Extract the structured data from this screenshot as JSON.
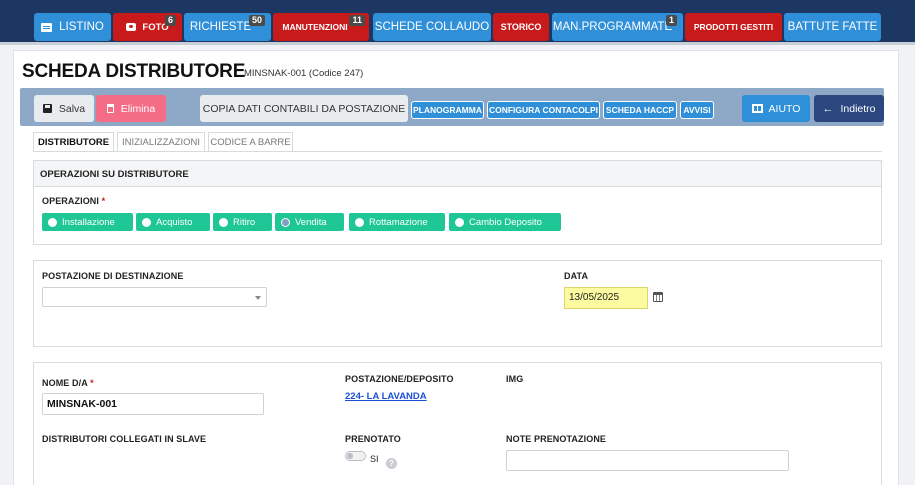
{
  "nav": {
    "listino": "LISTINO",
    "foto": "FOTO",
    "foto_badge": "6",
    "richieste": "RICHIESTE",
    "richieste_badge": "50",
    "manutenzioni": "MANUTENZIONI",
    "manutenzioni_badge": "11",
    "schede_collaudo": "SCHEDE COLLAUDO",
    "storico": "STORICO",
    "man_programmate": "MAN.PROGRAMMATE",
    "man_programmate_badge": "1",
    "prodotti_gestiti": "PRODOTTI GESTITI",
    "battute_fatte": "BATTUTE FATTE"
  },
  "page": {
    "title": "SCHEDA DISTRIBUTORE",
    "subtitle": "MINSNAK-001 (Codice 247)"
  },
  "toolbar": {
    "save": "Salva",
    "delete": "Elimina",
    "copy": "COPIA DATI CONTABILI DA POSTAZIONE",
    "planogramma": "PLANOGRAMMA",
    "configura": "CONFIGURA CONTACOLPI",
    "haccp": "SCHEDA HACCP",
    "avvisi": "AVVISI",
    "aiuto": "AIUTO",
    "indietro": "Indietro"
  },
  "tabs": [
    "DISTRIBUTORE",
    "INIZIALIZZAZIONI",
    "CODICE A BARRE"
  ],
  "operazioni": {
    "header": "OPERAZIONI SU DISTRIBUTORE",
    "label": "OPERAZIONI",
    "required": "*",
    "options": [
      "Installazione",
      "Acquisto",
      "Ritiro",
      "Vendita",
      "Rottamazione",
      "Cambio Deposito"
    ],
    "selected": "Vendita"
  },
  "destinazione": {
    "postazione_label": "POSTAZIONE DI DESTINAZIONE",
    "postazione_value": "",
    "data_label": "DATA",
    "data_value": "13/05/2025"
  },
  "dettagli": {
    "nome_label": "NOME D/A",
    "nome_required": "*",
    "nome_value": "MINSNAK-001",
    "postazione_label": "POSTAZIONE/DEPOSITO",
    "postazione_link": "224- LA LAVANDA",
    "img_label": "IMG",
    "slave_label": "DISTRIBUTORI COLLEGATI IN SLAVE",
    "prenotato_label": "PRENOTATO",
    "prenotato_toggle_text": "SI",
    "help_glyph": "?",
    "note_label": "NOTE PRENOTAZIONE",
    "note_value": ""
  },
  "colors": {
    "nav_bg": "#1d3763",
    "blue": "#2f8fd8",
    "red": "#c81a1a",
    "green": "#1ec795",
    "toolbar_bg": "#8ea9c8",
    "back_btn": "#2c4780",
    "delete_btn": "#f36d86",
    "date_bg": "#fbfaa0"
  }
}
